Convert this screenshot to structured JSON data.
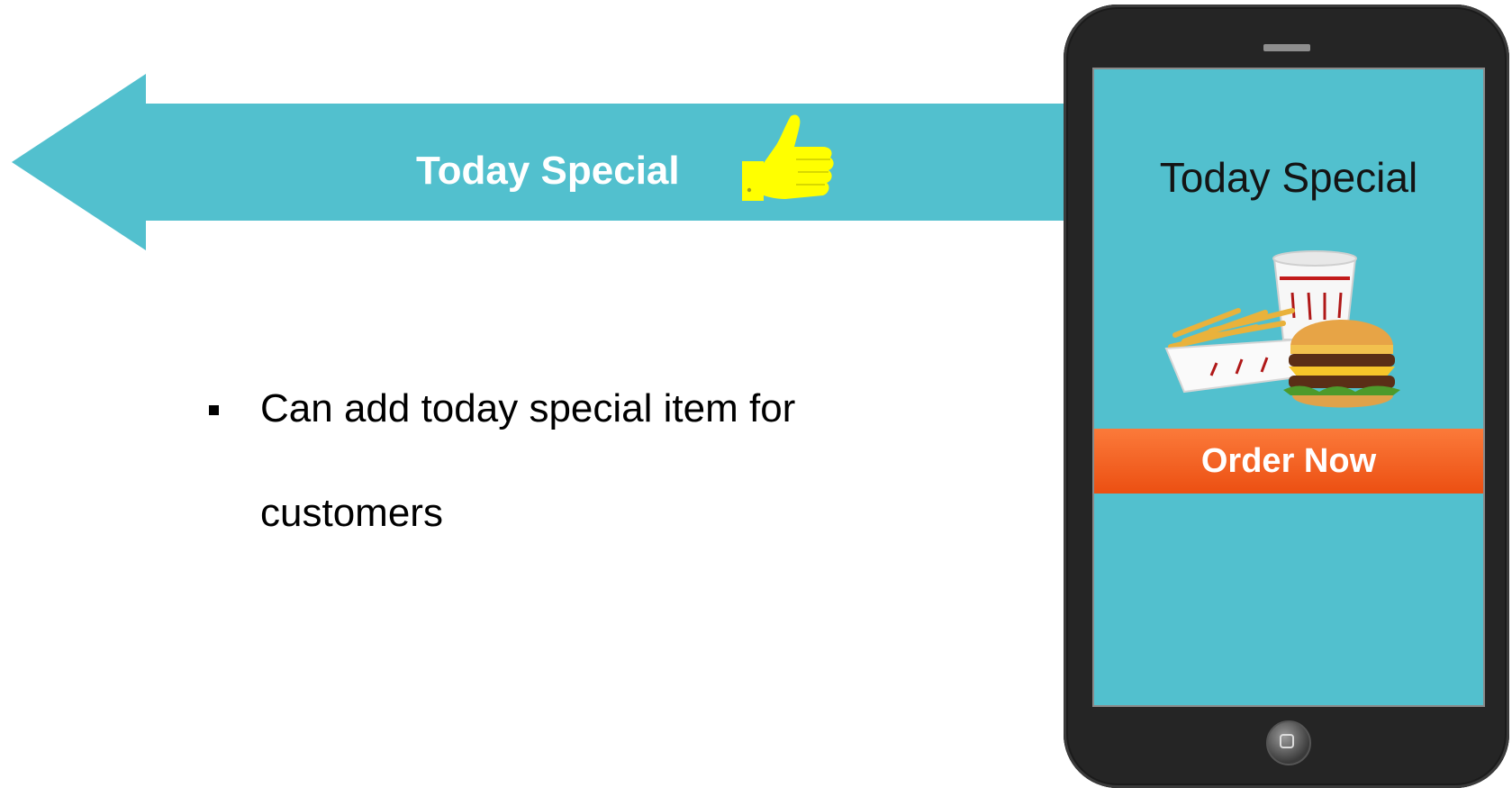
{
  "banner": {
    "label": "Today Special",
    "arrow_color": "#52c0ce",
    "icon": "thumbs-up-icon",
    "icon_color": "#ffff00"
  },
  "bullet": {
    "line1": "Can add today special item for",
    "line2": "customers"
  },
  "tablet": {
    "screen_title": "Today Special",
    "food_image": "burger-fries-drink-image",
    "order_button": "Order Now",
    "screen_color": "#52c0ce",
    "button_color": "#f05a1a"
  }
}
